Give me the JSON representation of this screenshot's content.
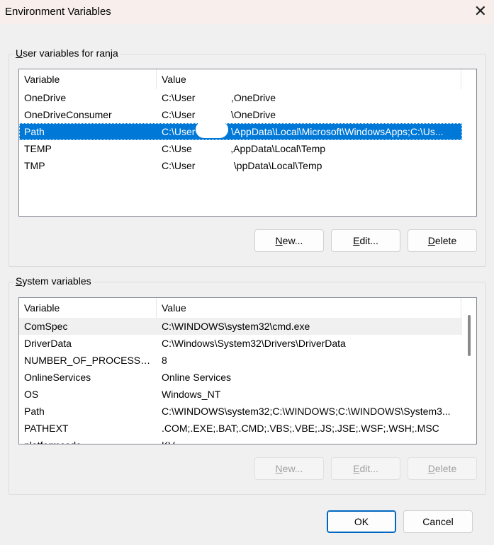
{
  "window": {
    "title": "Environment Variables",
    "close_icon": "close-icon"
  },
  "user": {
    "group_label": "User variables for ranja",
    "columns": [
      "Variable",
      "Value"
    ],
    "rows": [
      {
        "variable": "OneDrive",
        "value": "C:\\User             ,OneDrive"
      },
      {
        "variable": "OneDriveConsumer",
        "value": "C:\\User             \\OneDrive"
      },
      {
        "variable": "Path",
        "value": "C:\\User             \\AppData\\Local\\Microsoft\\WindowsApps;C:\\Us..."
      },
      {
        "variable": "TEMP",
        "value": "C:\\Use              ,AppData\\Local\\Temp"
      },
      {
        "variable": "TMP",
        "value": "C:\\User              \\ppData\\Local\\Temp"
      }
    ],
    "selected_index": 2,
    "buttons": {
      "new": "New...",
      "edit": "Edit...",
      "delete": "Delete"
    }
  },
  "system": {
    "group_label": "System variables",
    "columns": [
      "Variable",
      "Value"
    ],
    "rows": [
      {
        "variable": "ComSpec",
        "value": "C:\\WINDOWS\\system32\\cmd.exe"
      },
      {
        "variable": "DriverData",
        "value": "C:\\Windows\\System32\\Drivers\\DriverData"
      },
      {
        "variable": "NUMBER_OF_PROCESSORS",
        "value": "8"
      },
      {
        "variable": "OnlineServices",
        "value": "Online Services"
      },
      {
        "variable": "OS",
        "value": "Windows_NT"
      },
      {
        "variable": "Path",
        "value": "C:\\WINDOWS\\system32;C:\\WINDOWS;C:\\WINDOWS\\System3..."
      },
      {
        "variable": "PATHEXT",
        "value": ".COM;.EXE;.BAT;.CMD;.VBS;.VBE;.JS;.JSE;.WSF;.WSH;.MSC"
      },
      {
        "variable": "platformcode",
        "value": "KV"
      }
    ],
    "buttons": {
      "new": "New...",
      "edit": "Edit...",
      "delete": "Delete"
    }
  },
  "footer": {
    "ok": "OK",
    "cancel": "Cancel"
  }
}
